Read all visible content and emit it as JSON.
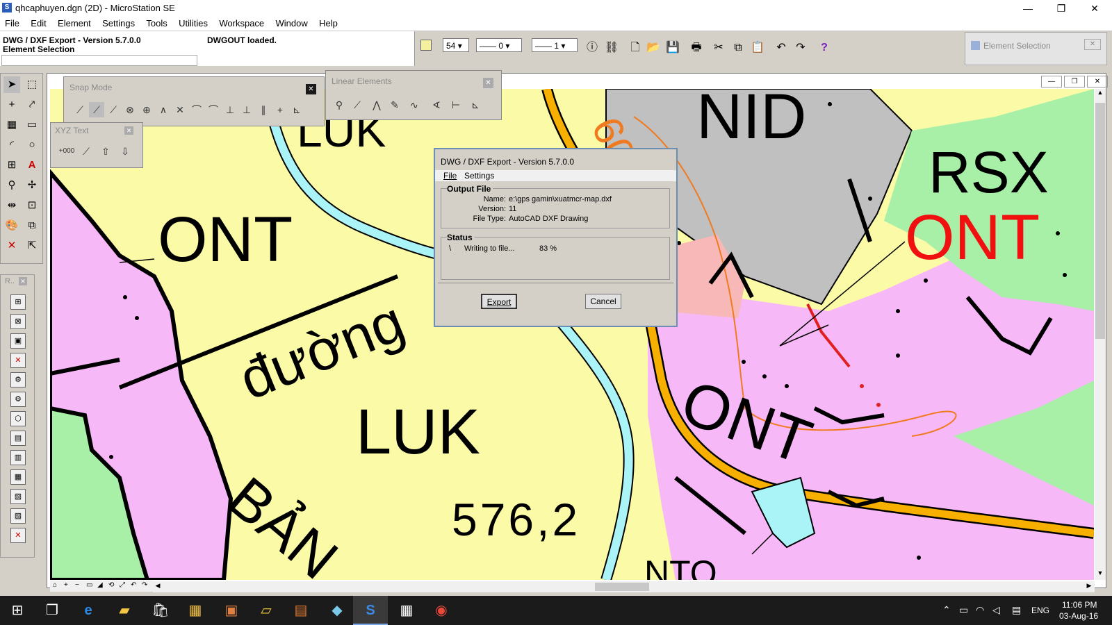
{
  "window": {
    "title": "qhcaphuyen.dgn (2D) - MicroStation SE",
    "minimize": "—",
    "restore": "❐",
    "close": "✕"
  },
  "menu": [
    "File",
    "Edit",
    "Element",
    "Settings",
    "Tools",
    "Utilities",
    "Workspace",
    "Window",
    "Help"
  ],
  "info": {
    "line1": "DWG / DXF Export - Version 5.7.0.0",
    "line2": "Element Selection",
    "message": "DWGOUT loaded."
  },
  "toolbar": {
    "color": "54",
    "style": "0",
    "weight": "1",
    "color_swatch": "#f4f0a0"
  },
  "element_selection": {
    "title": "Element Selection"
  },
  "snap_mode": {
    "title": "Snap Mode"
  },
  "linear_elements": {
    "title": "Linear Elements"
  },
  "xyz_text": {
    "title": "XYZ Text",
    "coord_label": "+000"
  },
  "left_palette2": {
    "title": "R.."
  },
  "map_labels": {
    "nid": "NID",
    "rsx": "RSX",
    "ont_red": "ONT",
    "ont_left": "ONT",
    "ont_center": "ONT",
    "duong": "đường",
    "luk_center": "LUK",
    "luk_top": "LUK",
    "ban": "BẢN",
    "value": "576,2",
    "road": "600",
    "nto": "NTO"
  },
  "dialog": {
    "title": "DWG / DXF Export - Version 5.7.0.0",
    "menu_file": "File",
    "menu_settings": "Settings",
    "output_group": "Output File",
    "name_label": "Name:",
    "name_value": "e:\\gps gamin\\xuatmcr-map.dxf",
    "version_label": "Version:",
    "version_value": "11",
    "filetype_label": "File Type:",
    "filetype_value": "AutoCAD DXF Drawing",
    "status_group": "Status",
    "spinner": "\\",
    "status_text": "Writing to file...",
    "progress": "83 %",
    "export_button": "Export",
    "cancel_button": "Cancel"
  },
  "taskbar": {
    "language": "ENG",
    "time": "11:06 PM",
    "date": "03-Aug-16"
  }
}
